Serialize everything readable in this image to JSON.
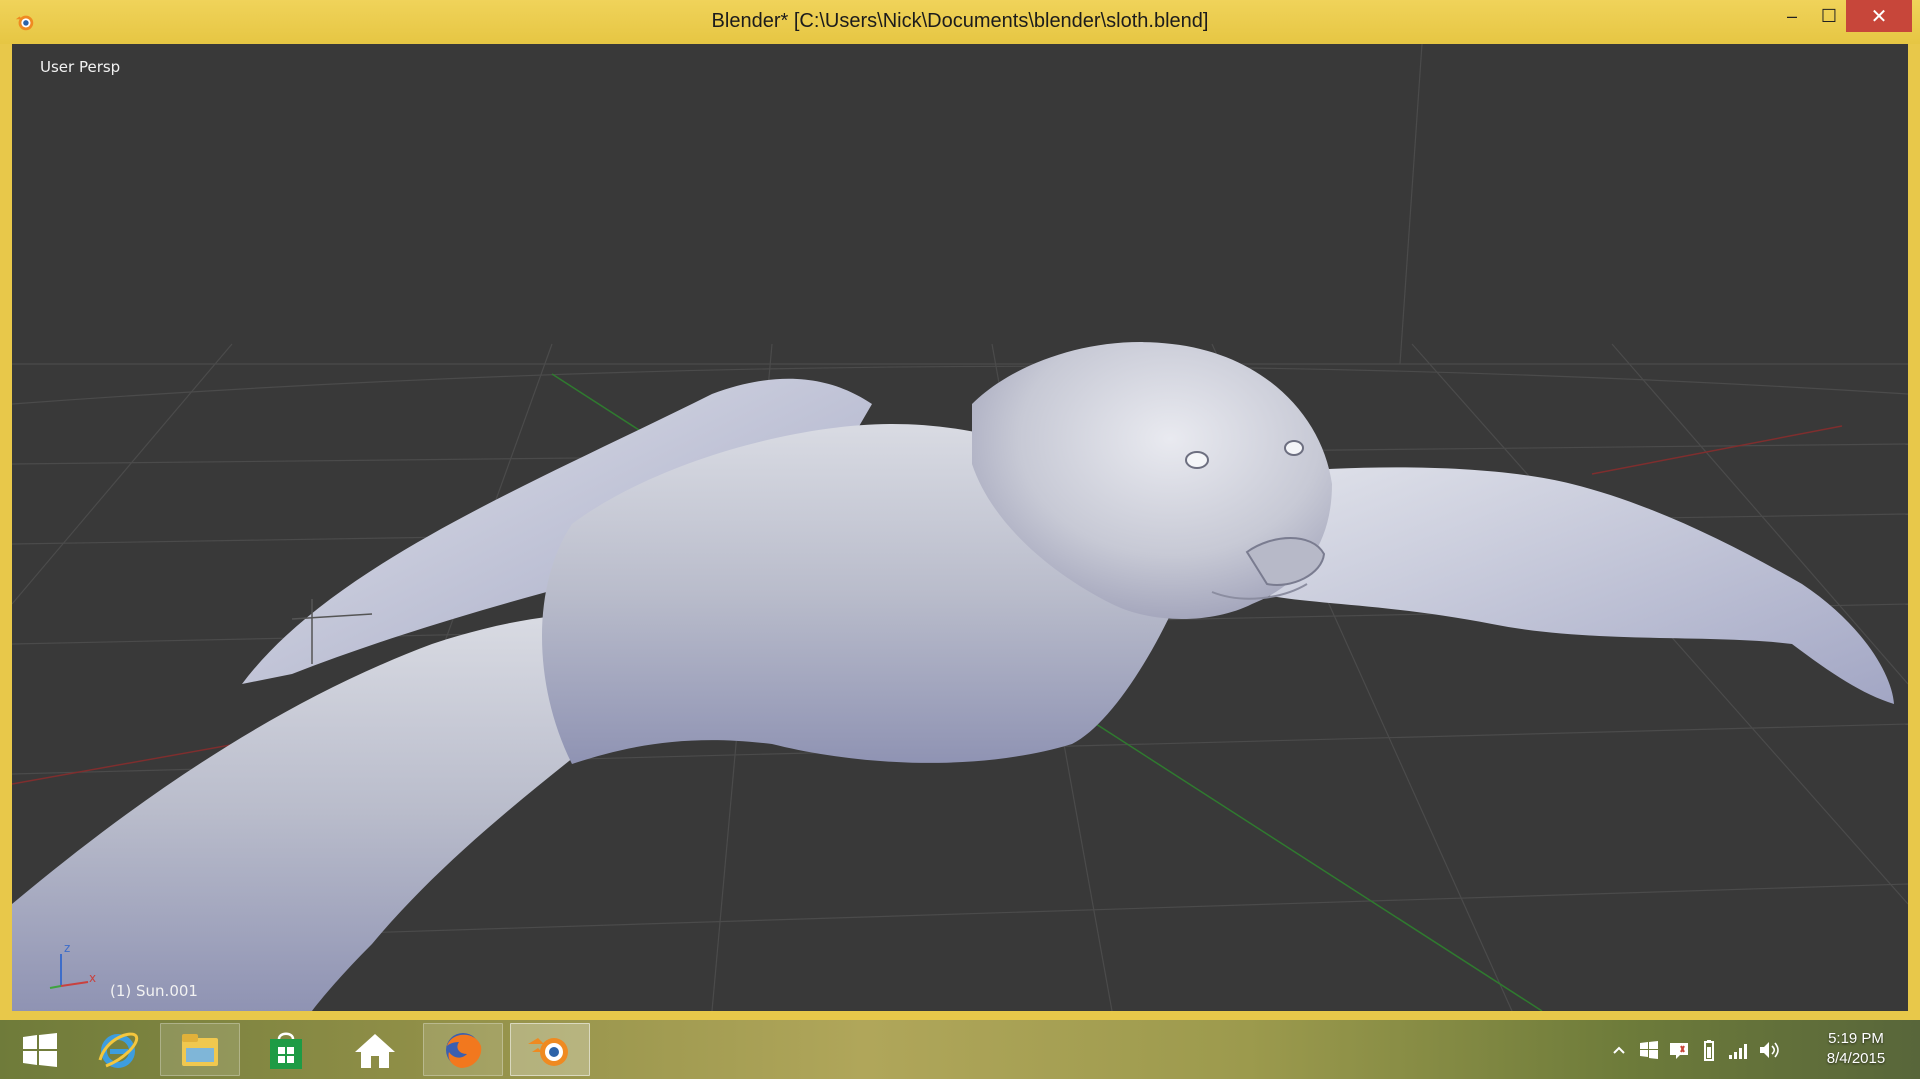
{
  "window": {
    "title": "Blender* [C:\\Users\\Nick\\Documents\\blender\\sloth.blend]",
    "minimize_glyph": "–",
    "maximize_glyph": "☐",
    "close_glyph": "✕"
  },
  "viewport": {
    "view_label": "User Persp",
    "active_object_label": "(1) Sun.001",
    "gizmo": {
      "z": "z",
      "x": "x"
    }
  },
  "taskbar": {
    "items": [
      {
        "name": "Start",
        "icon": "windows-logo-icon"
      },
      {
        "name": "Internet Explorer",
        "icon": "internet-explorer-icon"
      },
      {
        "name": "File Explorer",
        "icon": "file-explorer-icon"
      },
      {
        "name": "Store",
        "icon": "store-icon"
      },
      {
        "name": "Home",
        "icon": "home-icon"
      },
      {
        "name": "Firefox",
        "icon": "firefox-icon"
      },
      {
        "name": "Blender",
        "icon": "blender-icon"
      }
    ],
    "clock": {
      "time": "5:19 PM",
      "date": "8/4/2015"
    }
  },
  "colors": {
    "title_bar": "#e8c84a",
    "viewport_bg": "#393939",
    "grid": "#4c4c4c",
    "x_axis": "#8a2d2d",
    "y_axis": "#2e7d2e",
    "mesh": "#c9cbd6",
    "close_button": "#c7463a"
  }
}
